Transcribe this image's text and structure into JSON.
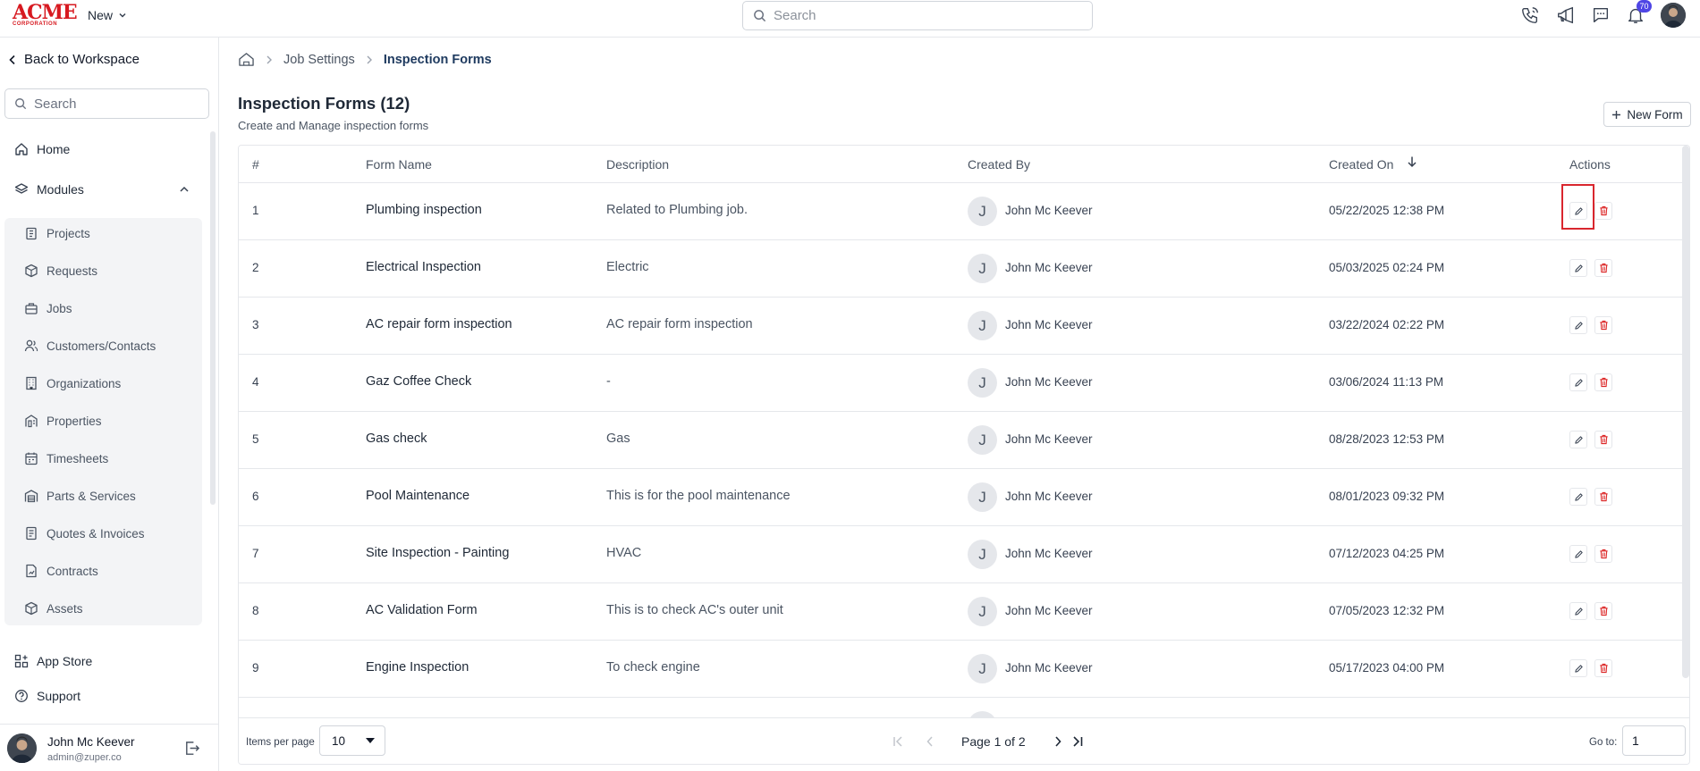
{
  "app": {
    "logo_text": "ACME",
    "logo_subtext": "CORPORATION",
    "new_label": "New",
    "search_placeholder": "Search",
    "notification_count": "70"
  },
  "sidebar": {
    "back_label": "Back to Workspace",
    "search_placeholder": "Search",
    "home_label": "Home",
    "modules_label": "Modules",
    "modules": [
      {
        "label": "Projects",
        "icon": "clipboard-icon"
      },
      {
        "label": "Requests",
        "icon": "box-icon"
      },
      {
        "label": "Jobs",
        "icon": "briefcase-icon"
      },
      {
        "label": "Customers/Contacts",
        "icon": "users-icon"
      },
      {
        "label": "Organizations",
        "icon": "building-icon"
      },
      {
        "label": "Properties",
        "icon": "property-icon"
      },
      {
        "label": "Timesheets",
        "icon": "calendar-icon"
      },
      {
        "label": "Parts & Services",
        "icon": "warehouse-icon"
      },
      {
        "label": "Quotes & Invoices",
        "icon": "receipt-icon"
      },
      {
        "label": "Contracts",
        "icon": "contract-icon"
      },
      {
        "label": "Assets",
        "icon": "cube-icon"
      }
    ],
    "app_store_label": "App Store",
    "support_label": "Support",
    "user": {
      "name": "John Mc Keever",
      "email": "admin@zuper.co"
    }
  },
  "breadcrumb": {
    "items": [
      "Job Settings",
      "Inspection Forms"
    ]
  },
  "page": {
    "title": "Inspection Forms (12)",
    "subtitle": "Create and Manage inspection forms",
    "new_button_label": "New Form"
  },
  "table": {
    "columns": [
      "#",
      "Form Name",
      "Description",
      "Created By",
      "Created On",
      "Actions"
    ],
    "rows": [
      {
        "num": "1",
        "name": "Plumbing inspection",
        "desc": "Related to Plumbing job.",
        "initial": "J",
        "by": "John Mc Keever",
        "date": "05/22/2025 12:38 PM"
      },
      {
        "num": "2",
        "name": "Electrical Inspection",
        "desc": "Electric",
        "initial": "J",
        "by": "John Mc Keever",
        "date": "05/03/2025 02:24 PM"
      },
      {
        "num": "3",
        "name": "AC repair form inspection",
        "desc": "AC repair form inspection",
        "initial": "J",
        "by": "John Mc Keever",
        "date": "03/22/2024 02:22 PM"
      },
      {
        "num": "4",
        "name": "Gaz Coffee Check",
        "desc": "-",
        "initial": "J",
        "by": "John Mc Keever",
        "date": "03/06/2024 11:13 PM"
      },
      {
        "num": "5",
        "name": "Gas check",
        "desc": "Gas",
        "initial": "J",
        "by": "John Mc Keever",
        "date": "08/28/2023 12:53 PM"
      },
      {
        "num": "6",
        "name": "Pool Maintenance",
        "desc": "This is for the pool maintenance",
        "initial": "J",
        "by": "John Mc Keever",
        "date": "08/01/2023 09:32 PM"
      },
      {
        "num": "7",
        "name": "Site Inspection - Painting",
        "desc": "HVAC",
        "initial": "J",
        "by": "John Mc Keever",
        "date": "07/12/2023 04:25 PM"
      },
      {
        "num": "8",
        "name": "AC Validation Form",
        "desc": "This is to check AC's outer unit",
        "initial": "J",
        "by": "John Mc Keever",
        "date": "07/05/2023 12:32 PM"
      },
      {
        "num": "9",
        "name": "Engine Inspection",
        "desc": "To check engine",
        "initial": "J",
        "by": "John Mc Keever",
        "date": "05/17/2023 04:00 PM"
      }
    ]
  },
  "pagination": {
    "items_per_page_label": "Items per page",
    "items_per_page_value": "10",
    "page_text": "Page 1 of 2",
    "goto_label": "Go to:",
    "goto_value": "1"
  }
}
